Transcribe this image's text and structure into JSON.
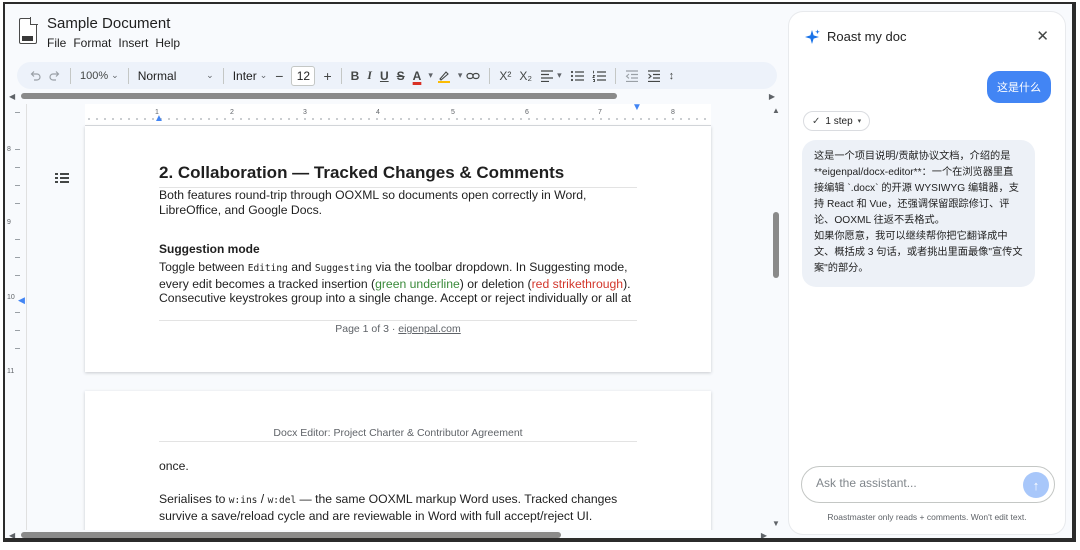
{
  "document": {
    "title": "Sample Document",
    "menu": [
      "File",
      "Format",
      "Insert",
      "Help"
    ]
  },
  "toolbar": {
    "undo_icon": "undo-icon",
    "redo_icon": "redo-icon",
    "zoom": "100%",
    "style": "Normal",
    "font": "Inter",
    "font_size": "12",
    "minus": "−",
    "plus": "+",
    "bold": "B",
    "italic": "I",
    "underline": "U",
    "strike": "S",
    "text_color": "A",
    "superscript": "X²",
    "subscript": "X₂"
  },
  "ruler": {
    "h_numbers": [
      "1",
      "2",
      "3",
      "4",
      "5",
      "6",
      "7",
      "8"
    ],
    "v_numbers": [
      "8",
      "9",
      "10",
      "11"
    ]
  },
  "page1": {
    "heading": "2. Collaboration — Tracked Changes & Comments",
    "intro": "Both features round-trip through OOXML so documents open correctly in Word, LibreOffice, and Google Docs.",
    "subheading": "Suggestion mode",
    "p_toggle": "Toggle between ",
    "code_editing": "Editing",
    "p_and": " and ",
    "code_suggesting": "Suggesting",
    "p_rest1": " via the toolbar dropdown. In Suggesting mode, every edit becomes a tracked insertion (",
    "green_text": "green underline",
    "p_or": ") or deletion (",
    "red_text": "red strikethrough",
    "p_rest2": "). Consecutive keystrokes group into a single change. Accept or reject individually or all at",
    "footer_prefix": "Page 1 of 3 · ",
    "footer_link": "eigenpal.com"
  },
  "page2": {
    "header": "Docx Editor: Project Charter & Contributor Agreement",
    "continued": "once.",
    "p_serialises": "Serialises to ",
    "code_ins": "w:ins",
    "p_slash": " / ",
    "code_del": "w:del",
    "p_rest": " — the same OOXML markup Word uses. Tracked changes survive a save/reload cycle and are reviewable in Word with full accept/reject UI."
  },
  "assistant": {
    "title": "Roast my doc",
    "user_message": "这是什么",
    "step_label": "1 step",
    "reply_p1": "这是一个项目说明/贡献协议文档，介绍的是 **eigenpal/docx-editor**：一个在浏览器里直接编辑 `.docx` 的开源 WYSIWYG 编辑器，支持 React 和 Vue，还强调保留跟踪修订、评论、OOXML 往返不丢格式。",
    "reply_p2": "如果你愿意，我可以继续帮你把它翻译成中文、概括成 3 句话，或者挑出里面最像\"宣传文案\"的部分。",
    "input_placeholder": "Ask the assistant...",
    "disclaimer": "Roastmaster only reads + comments. Won't edit text.",
    "accent": "#4285f4"
  }
}
